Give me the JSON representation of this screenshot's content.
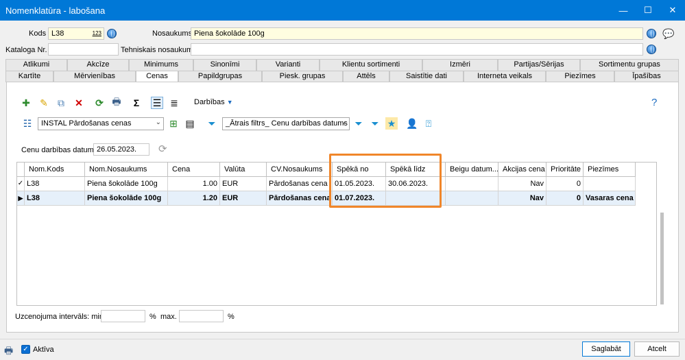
{
  "window": {
    "title": "Nomenklatūra - labošana",
    "minimize": "—",
    "maximize": "☐",
    "close": "✕"
  },
  "header": {
    "kods_label": "Kods",
    "kods_value": "L38",
    "kods_badge": "123",
    "nosaukums_label": "Nosaukums",
    "nosaukums_value": "Piena šokolāde 100g",
    "kataloga_label": "Kataloga Nr.",
    "kataloga_value": "",
    "tehniskais_label": "Tehniskais nosaukums",
    "tehniskais_value": ""
  },
  "tabs_top": [
    "Atlikumi",
    "Akcīze",
    "Minimums",
    "Sinonīmi",
    "Varianti",
    "Klientu sortimenti",
    "Izmēri",
    "Partijas/Sērijas",
    "Sortimentu grupas"
  ],
  "tabs_bottom": [
    "Kartīte",
    "Mērvienības",
    "Cenas",
    "Papildgrupas",
    "Piesk. grupas",
    "Attēls",
    "Saistītie dati",
    "Interneta veikals",
    "Piezīmes",
    "Īpašības"
  ],
  "toolbar": {
    "darbibas_label": "Darbības",
    "help": "?",
    "sigma": "Σ"
  },
  "filters": {
    "list_select": "INSTAL Pārdošanas cenas",
    "quick_filter": "_Ātrais filtrs_ Cenu darbības datums"
  },
  "date_filter": {
    "label": "Cenu darbības datums",
    "value": "26.05.2023."
  },
  "grid": {
    "columns": [
      "Nom.Kods",
      "Nom.Nosaukums",
      "Cena",
      "Valūta",
      "CV.Nosaukums",
      "Spēkā no",
      "Spēkā līdz",
      "Beigu datum...",
      "Akcijas cena",
      "Prioritāte",
      "Piezīmes"
    ],
    "rows": [
      {
        "marker": "✓",
        "kods": "L38",
        "nosaukums": "Piena šokolāde 100g",
        "cena": "1.00",
        "valuta": "EUR",
        "cv": "Pārdošanas cena",
        "no": "01.05.2023.",
        "lidz": "30.06.2023.",
        "beigu": "",
        "akcijas": "Nav",
        "prioritate": "0",
        "piezimes": ""
      },
      {
        "marker": "▶",
        "kods": "L38",
        "nosaukums": "Piena šokolāde 100g",
        "cena": "1.20",
        "valuta": "EUR",
        "cv": "Pārdošanas cena",
        "no": "01.07.2023.",
        "lidz": "",
        "beigu": "",
        "akcijas": "Nav",
        "prioritate": "0",
        "piezimes": "Vasaras cena"
      }
    ]
  },
  "margin_filter": {
    "label": "Uzcenojuma intervāls: min.",
    "min_value": "",
    "pct1": "%",
    "max_label": "max.",
    "max_value": "",
    "pct2": "%"
  },
  "footer": {
    "active_label": "Aktīva",
    "save_label": "Saglabāt",
    "cancel_label": "Atcelt"
  },
  "colors": {
    "titlebar": "#0078d7",
    "highlight": "#f0862a",
    "selected_row": "#e6f0fa",
    "required_field": "#fffde0"
  }
}
